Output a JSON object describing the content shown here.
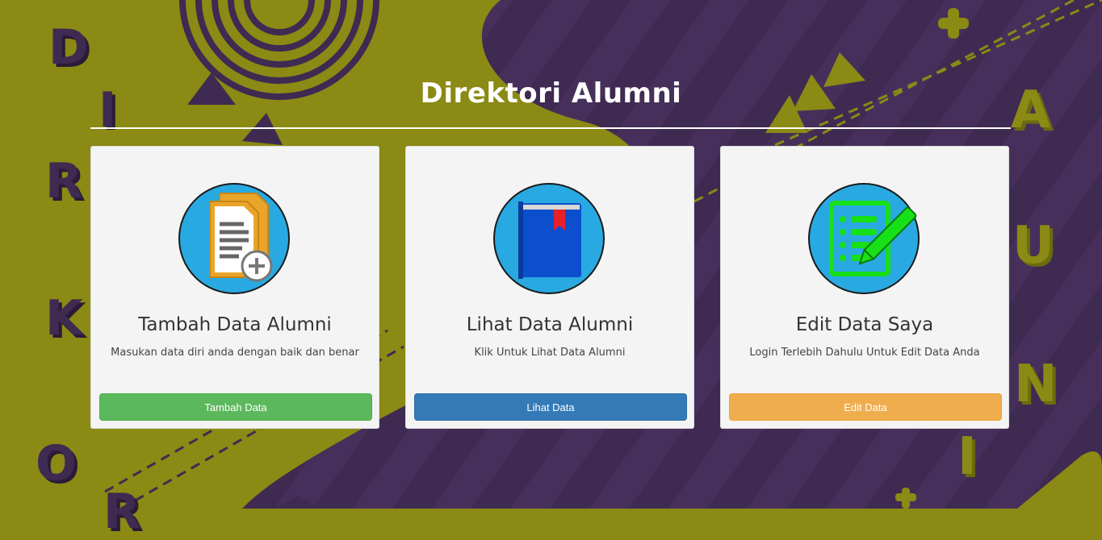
{
  "page": {
    "title": "Direktori Alumni",
    "decor_left_letters": [
      "D",
      "I",
      "R",
      "K",
      "O",
      "R"
    ],
    "decor_right_letters": [
      "A",
      "U",
      "N",
      "I"
    ]
  },
  "cards": [
    {
      "title": "Tambah Data Alumni",
      "description": "Masukan data diri anda dengan baik dan benar",
      "button_label": "Tambah Data",
      "button_color": "#5cb85c",
      "icon": "add-document-icon"
    },
    {
      "title": "Lihat Data Alumni",
      "description": "Klik Untuk Lihat Data Alumni",
      "button_label": "Lihat Data",
      "button_color": "#337ab7",
      "icon": "book-icon"
    },
    {
      "title": "Edit Data Saya",
      "description": "Login Terlebih Dahulu Untuk Edit Data Anda",
      "button_label": "Edit Data",
      "button_color": "#f0ad4e",
      "icon": "edit-list-icon"
    }
  ],
  "colors": {
    "background_olive": "#8a8a14",
    "background_purple": "#3f2a52",
    "card_bg": "#f4f4f4",
    "icon_circle": "#29a9e1"
  }
}
